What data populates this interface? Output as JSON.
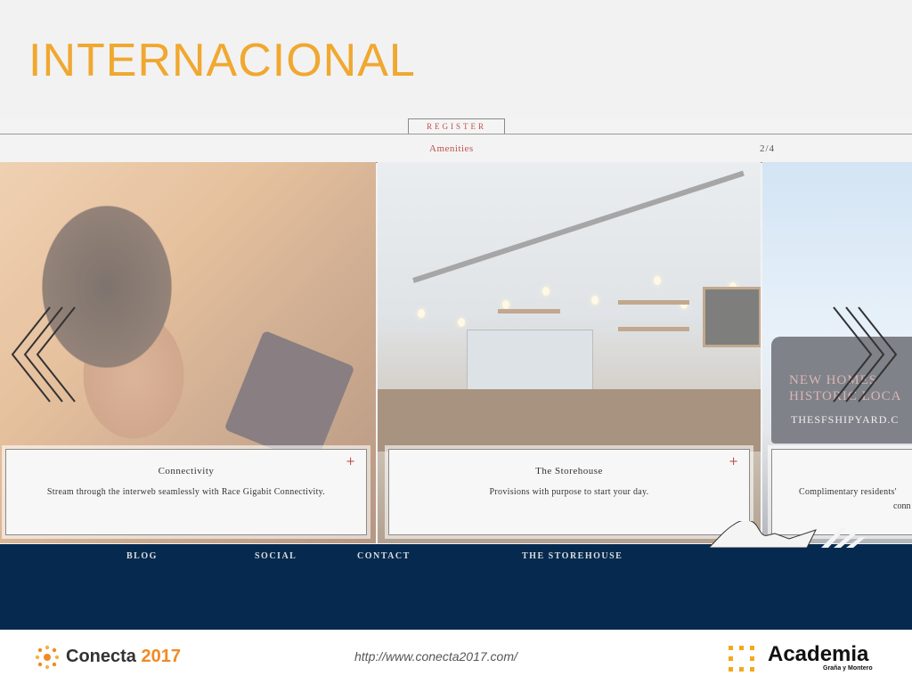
{
  "slide": {
    "title": "INTERNACIONAL",
    "title_color": "#f0a830",
    "url": "http://www.conecta2017.com/"
  },
  "site": {
    "register_label": "REGISTER",
    "section_label": "Amenities",
    "page_indicator": "2/4",
    "accent_color": "#c0504d",
    "nav_bg": "#062a4f",
    "prev_icon": "chevron-left-icon",
    "next_icon": "chevron-right-icon",
    "panels": [
      {
        "image": "woman-with-tablet",
        "title": "Connectivity",
        "text": "Stream through the interweb seamlessly with Race Gigabit Connectivity.",
        "expand_icon": "+"
      },
      {
        "image": "storehouse-interior",
        "title": "The Storehouse",
        "text": "Provisions with purpose to start your day.",
        "expand_icon": "+"
      },
      {
        "image": "van-outdoors",
        "text_line1": "Complimentary residents'",
        "text_line2": "conn",
        "van_text_1": "NEW HOMES",
        "van_text_2": "HISTORIC LOCA",
        "van_text_3": "THESFSHIPYARD.C"
      }
    ],
    "nav": [
      "BLOG",
      "SOCIAL",
      "CONTACT",
      "THE STOREHOUSE"
    ]
  },
  "logos": {
    "conecta_name": "Conecta",
    "conecta_year": "2017",
    "conecta_color": "#f08a24",
    "academia_name": "Academia",
    "academia_sub": "Graña y Montero",
    "academia_color": "#f4a81d"
  }
}
